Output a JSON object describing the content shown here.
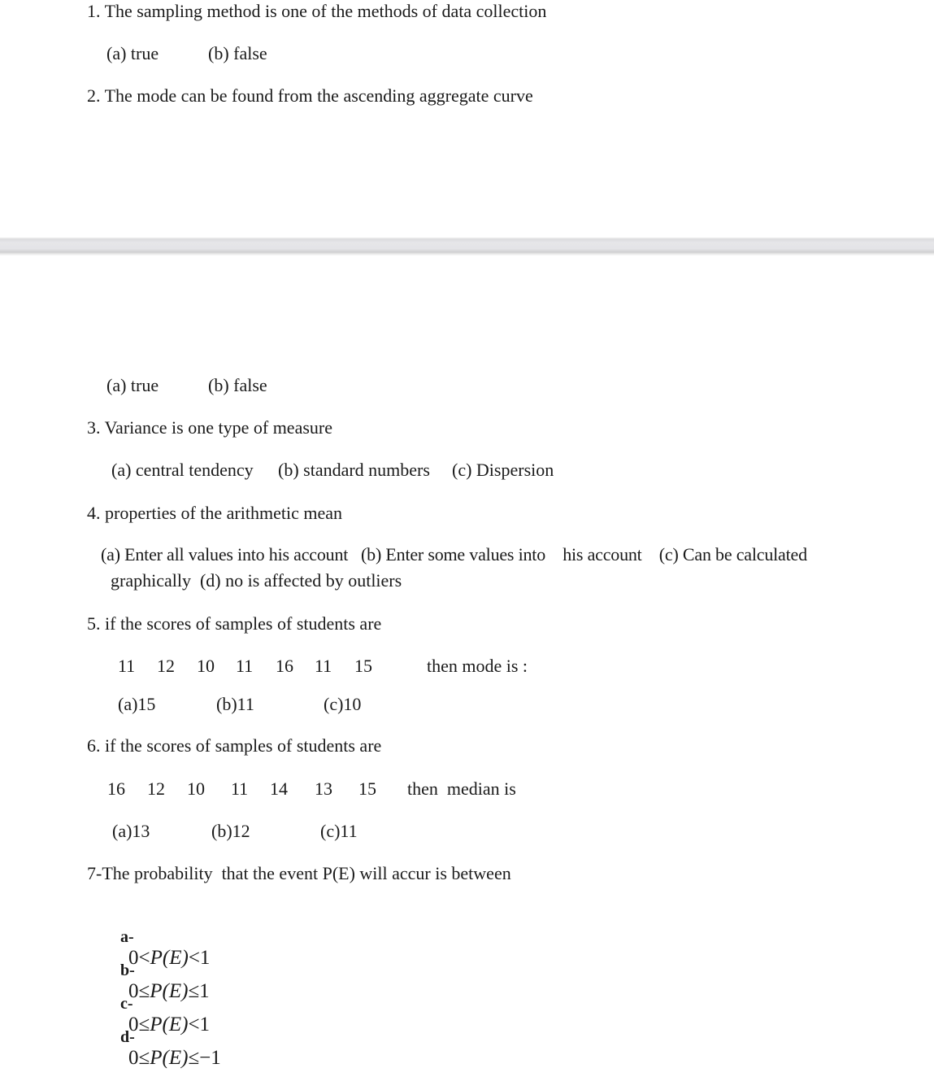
{
  "q1": {
    "question": "1. The sampling method is one of the methods of data collection",
    "options": [
      "(a) true",
      "(b) false"
    ]
  },
  "q2": {
    "question": "2. The mode can be found from the ascending aggregate curve",
    "options": [
      "(a) true",
      "(b) false"
    ]
  },
  "q3": {
    "question": "3. Variance is one type of measure",
    "options": [
      "(a) central tendency",
      "(b) standard numbers",
      "(c) Dispersion"
    ]
  },
  "q4": {
    "question": "4. properties of the arithmetic mean",
    "line1": "(a) Enter all values into his account   (b) Enter some values into    his account    (c) Can be calculated",
    "line2": "graphically  (d) no is affected by outliers"
  },
  "q5": {
    "question": "5. if the scores of samples of students are",
    "scores": [
      "11",
      "12",
      "10",
      "11",
      "16",
      "11",
      "15"
    ],
    "prompt": "then mode is :",
    "options": [
      "(a)15",
      "(b)11",
      "(c)10"
    ]
  },
  "q6": {
    "question": "6. if the scores of samples of students are",
    "scores": [
      "16",
      "12",
      "10",
      "11",
      "14",
      "13",
      "15"
    ],
    "prompt": "then  median is",
    "options": [
      "(a)13",
      "(b)12",
      "(c)11"
    ]
  },
  "q7": {
    "question": "7-The probability  that the event P(E) will accur is between",
    "options": [
      {
        "label": "a-",
        "left": "0<",
        "right": "<1"
      },
      {
        "label": "b-",
        "left": "0≤",
        "right": "≤1"
      },
      {
        "label": "c-",
        "left": "0≤",
        "right": "<1"
      },
      {
        "label": "d-",
        "left": "0≤",
        "right": "≤−1"
      }
    ],
    "expr": "P(E)"
  }
}
